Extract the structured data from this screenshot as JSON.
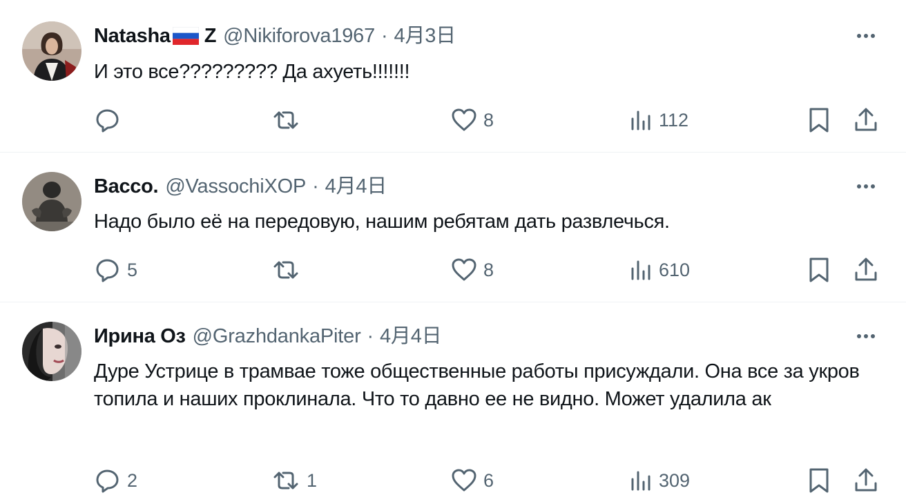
{
  "tweets": [
    {
      "author": "Natasha",
      "author_suffix": "Z",
      "has_flag": true,
      "handle": "@Nikiforova1967",
      "separator": "·",
      "date": "4月3日",
      "text": "И это все????????? Да ахуеть!!!!!!!",
      "replies": "",
      "retweets": "",
      "likes": "8",
      "views": "112"
    },
    {
      "author": "Bacco.",
      "author_suffix": "",
      "has_flag": false,
      "handle": "@VassochiXOP",
      "separator": "·",
      "date": "4月4日",
      "text": "Надо было её на передовую, нашим ребятам дать развлечься.",
      "replies": "5",
      "retweets": "",
      "likes": "8",
      "views": "610"
    },
    {
      "author": "Ирина Оз",
      "author_suffix": "",
      "has_flag": false,
      "handle": "@GrazhdankaPiter",
      "separator": "·",
      "date": "4月4日",
      "text": "Дуре Устрице в трамвае тоже общественные работы присуждали. Она все за укров топила и наших проклинала. Что то давно ее не видно. Может удалила ак",
      "replies": "2",
      "retweets": "1",
      "likes": "6",
      "views": "309"
    }
  ],
  "colors": {
    "text": "#0f1419",
    "secondary": "#536471",
    "divider": "#eff3f4",
    "flag_white": "#ffffff",
    "flag_blue": "#1c57c9",
    "flag_red": "#e0262b"
  },
  "icons": {
    "reply": "reply-icon",
    "retweet": "retweet-icon",
    "like": "heart-icon",
    "views": "views-icon",
    "bookmark": "bookmark-icon",
    "share": "share-icon",
    "more": "more-icon"
  }
}
